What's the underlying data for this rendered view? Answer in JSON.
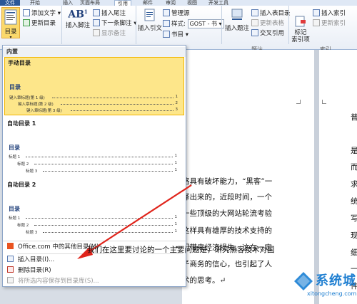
{
  "ribbon_tabs": {
    "file": "文件",
    "tab1": "开始",
    "tab2": "插入",
    "tab3": "页面布局",
    "tab4": "引用",
    "tab5": "邮件",
    "tab6": "审阅",
    "tab7": "视图",
    "tab8": "开发工具"
  },
  "ribbon": {
    "toc_button": "目录",
    "add_text": "添加文字",
    "update_toc": "更新目录",
    "footnote_big": "插入脚注",
    "insert_endnote": "插入尾注",
    "next_footnote": "下一条脚注",
    "show_notes": "显示备注",
    "insert_citation": "插入引文",
    "manage_sources": "管理源",
    "style_label": "样式:",
    "style_value": "GOST - 书",
    "bibliography": "书目",
    "insert_caption": "插入题注",
    "insert_table_of_figures": "插入表目录",
    "update_table": "更新表格",
    "cross_reference": "交叉引用",
    "captions_group": "题注",
    "mark_entry": "标记\n索引项",
    "insert_index": "插入索引",
    "update_index": "更新索引",
    "index_group": "索引",
    "colors": {
      "accent": "#2b5797",
      "ribbon_bg": "#e9eef6",
      "selected_card": "#fde68a"
    }
  },
  "dropdown": {
    "builtin_header": "内置",
    "cards": [
      {
        "name": "手动目录",
        "toc_title": "目录",
        "rows": [
          {
            "text": "键入章标题(第 1 级)",
            "num": "1"
          },
          {
            "text": "键入章标题(第 2 级)",
            "num": "2"
          },
          {
            "text": "键入章标题(第 3 级)",
            "num": "3"
          }
        ]
      },
      {
        "name": "自动目录 1",
        "toc_title": "目录",
        "rows": [
          {
            "text": "标题 1",
            "num": "1"
          },
          {
            "text": "标题 2",
            "num": "1"
          },
          {
            "text": "标题 3",
            "num": "1"
          }
        ]
      },
      {
        "name": "自动目录 2",
        "toc_title": "目录",
        "rows": [
          {
            "text": "标题 1",
            "num": "1"
          },
          {
            "text": "标题 2",
            "num": "1"
          },
          {
            "text": "标题 3",
            "num": "1"
          }
        ]
      }
    ],
    "menu": {
      "office_more": "Office.com 中的其他目录(M)",
      "insert_toc": "插入目录(I)...",
      "delete_toc": "删除目录(R)",
      "save_selection": "将所选内容保存到目录库(S)..."
    }
  },
  "document": {
    "left_lines": [
      "络具有破坏能力，“黑客”一",
      "译出来的，近段时间，一个",
      "一些顶级的大网站轮流考验",
      "这样具有雄厚的技术支持的",
      "们带来经济损失。这在一定",
      "子商务的信心，也引起了人",
      "术的思考。↵",
      "我们在这里要讨论的一个主要问题是，研究黑客技术对国"
    ],
    "right_chars": [
      "普",
      "是",
      "而",
      "求",
      "统",
      "写",
      "现",
      "细",
      "一",
      "件"
    ]
  },
  "watermark": {
    "text": "系统城",
    "url": "xitongcheng.com"
  }
}
